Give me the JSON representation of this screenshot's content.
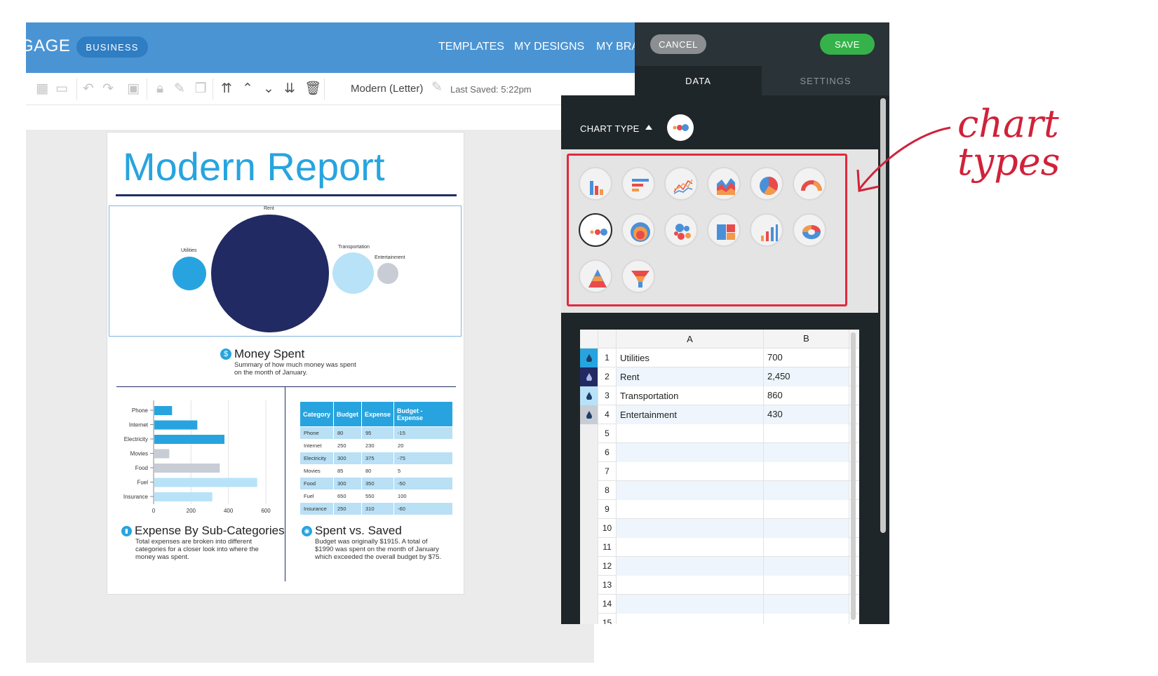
{
  "app": {
    "brand_fragment": "GAGE",
    "badge": "BUSINESS",
    "nav": [
      "TEMPLATES",
      "MY DESIGNS",
      "MY BRA"
    ]
  },
  "toolbar": {
    "doc_name": "Modern (Letter)",
    "last_saved": "Last Saved: 5:22pm"
  },
  "report": {
    "title": "Modern Report",
    "bubble_chart": {
      "labels": [
        "Rent",
        "Utilities",
        "Transportation",
        "Entertainment"
      ],
      "colors": [
        "#212a62",
        "#27a4df",
        "#b8e2f7",
        "#c8ccd5"
      ]
    },
    "money_spent": {
      "title": "Money Spent",
      "subtitle": "Summary of how much money was spent on the month of January."
    },
    "expense": {
      "title": "Expense By Sub-Categories",
      "subtitle": "Total expenses are broken into different categories for a closer look into where the money was spent."
    },
    "spent_saved": {
      "title": "Spent vs. Saved",
      "subtitle": "Budget was originally $1915. A total of $1990 was spent on the month of January which exceeded the overall budget by $75."
    },
    "table": {
      "headers": [
        "Category",
        "Budget",
        "Expense",
        "Budget - Expense"
      ],
      "rows": [
        [
          "Phone",
          "80",
          "95",
          "-15"
        ],
        [
          "Internet",
          "250",
          "230",
          "20"
        ],
        [
          "Electricity",
          "300",
          "375",
          "-75"
        ],
        [
          "Movies",
          "85",
          "80",
          "5"
        ],
        [
          "Food",
          "300",
          "350",
          "-50"
        ],
        [
          "Fuel",
          "650",
          "550",
          "100"
        ],
        [
          "Insurance",
          "250",
          "310",
          "-60"
        ]
      ]
    }
  },
  "chart_data": {
    "type": "bar",
    "orientation": "horizontal",
    "categories": [
      "Phone",
      "Internet",
      "Electricity",
      "Movies",
      "Food",
      "Fuel",
      "Insurance"
    ],
    "values": [
      95,
      230,
      375,
      80,
      350,
      550,
      310
    ],
    "colors": [
      "#27a4df",
      "#27a4df",
      "#27a4df",
      "#c8ccd5",
      "#c8ccd5",
      "#b8e2f7",
      "#b8e2f7"
    ],
    "xlim": [
      0,
      600
    ],
    "xticks": [
      "0",
      "200",
      "400",
      "600"
    ],
    "grid": true
  },
  "panel": {
    "cancel": "CANCEL",
    "save": "SAVE",
    "tabs": [
      "DATA",
      "SETTINGS"
    ],
    "chart_type_label": "CHART TYPE",
    "chart_types": [
      "column-chart-icon",
      "bar-chart-icon",
      "line-chart-icon",
      "area-chart-icon",
      "pie-chart-icon",
      "gauge-chart-icon",
      "bubble-chart-icon",
      "radial-chart-icon",
      "cluster-bubble-icon",
      "treemap-icon",
      "progress-column-icon",
      "donut-chart-icon",
      "pyramid-chart-icon",
      "funnel-chart-icon"
    ],
    "sheet": {
      "columns": [
        "A",
        "B"
      ],
      "rows": [
        {
          "n": "1",
          "a": "Utilities",
          "b": "700",
          "color": "#27a4df"
        },
        {
          "n": "2",
          "a": "Rent",
          "b": "2,450",
          "color": "#212a62"
        },
        {
          "n": "3",
          "a": "Transportation",
          "b": "860",
          "color": "#b8e2f7"
        },
        {
          "n": "4",
          "a": "Entertainment",
          "b": "430",
          "color": "#c8ccd5"
        },
        {
          "n": "5",
          "a": "",
          "b": ""
        },
        {
          "n": "6",
          "a": "",
          "b": ""
        },
        {
          "n": "7",
          "a": "",
          "b": ""
        },
        {
          "n": "8",
          "a": "",
          "b": ""
        },
        {
          "n": "9",
          "a": "",
          "b": ""
        },
        {
          "n": "10",
          "a": "",
          "b": ""
        },
        {
          "n": "11",
          "a": "",
          "b": ""
        },
        {
          "n": "12",
          "a": "",
          "b": ""
        },
        {
          "n": "13",
          "a": "",
          "b": ""
        },
        {
          "n": "14",
          "a": "",
          "b": ""
        },
        {
          "n": "15",
          "a": "",
          "b": ""
        }
      ]
    }
  },
  "annotation": {
    "line1": "chart",
    "line2": "types"
  }
}
